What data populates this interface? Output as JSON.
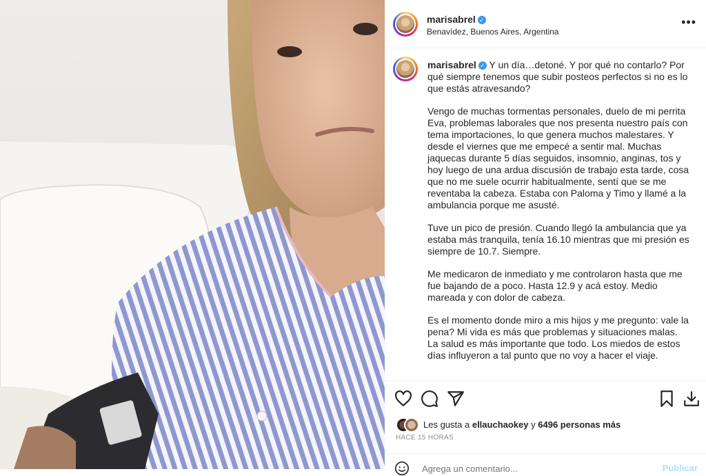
{
  "post": {
    "username": "marisabrel",
    "verified_mark": "✓",
    "location": "Benavídez, Buenos Aires, Argentina",
    "more_label": "•••"
  },
  "caption": {
    "username": "marisabrel",
    "paragraphs": [
      "Y un día…detoné. Y por qué no contarlo? Por qué siempre tenemos que subir posteos perfectos si no es lo que estás atravesando?",
      "Vengo de muchas tormentas personales, duelo de mi perrita Eva, problemas laborales que nos presenta nuestro país con tema importaciones, lo que genera muchos malestares. Y desde el viernes que me empecé a sentir mal. Muchas jaquecas durante 5 días seguidos, insomnio, anginas, tos y hoy luego de una ardua discusión de trabajo esta tarde, cosa que no me suele ocurrir habitualmente, sentí que se me reventaba la cabeza. Estaba con Paloma y Timo y llamé a la ambulancia porque me asusté.",
      "Tuve un pico de presión. Cuando llegó la ambulancia que ya estaba más tranquila, tenía 16.10 mientras que mi presión es siempre de 10.7. Siempre.",
      "Me medicaron de inmediato y me controlaron hasta que me fue bajando de a poco. Hasta 12.9 y acá estoy. Medio mareada y con dolor de cabeza.",
      "Es el momento donde miro a mis hijos y me pregunto: vale la pena? Mi vida es más que problemas y situaciones malas. La salud es más importante que todo. Los miedos de estos días influyeron a tal punto que no voy a hacer el viaje."
    ]
  },
  "engagement": {
    "likes_prefix": "Les gusta a",
    "liker": "ellauchaokey",
    "likes_joiner": "y",
    "others": "6496 personas más",
    "time_ago": "HACE 15 HORAS"
  },
  "comment": {
    "placeholder": "Agrega un comentario...",
    "publish_label": "Publicar"
  },
  "icons": {
    "like": "heart-icon",
    "comment": "comment-icon",
    "share": "share-icon",
    "save": "bookmark-icon",
    "download": "download-icon",
    "emoji": "emoji-icon"
  },
  "colors": {
    "verified": "#3897f0",
    "publish_disabled": "#b2dffc",
    "muted_text": "#8e8e8e"
  }
}
